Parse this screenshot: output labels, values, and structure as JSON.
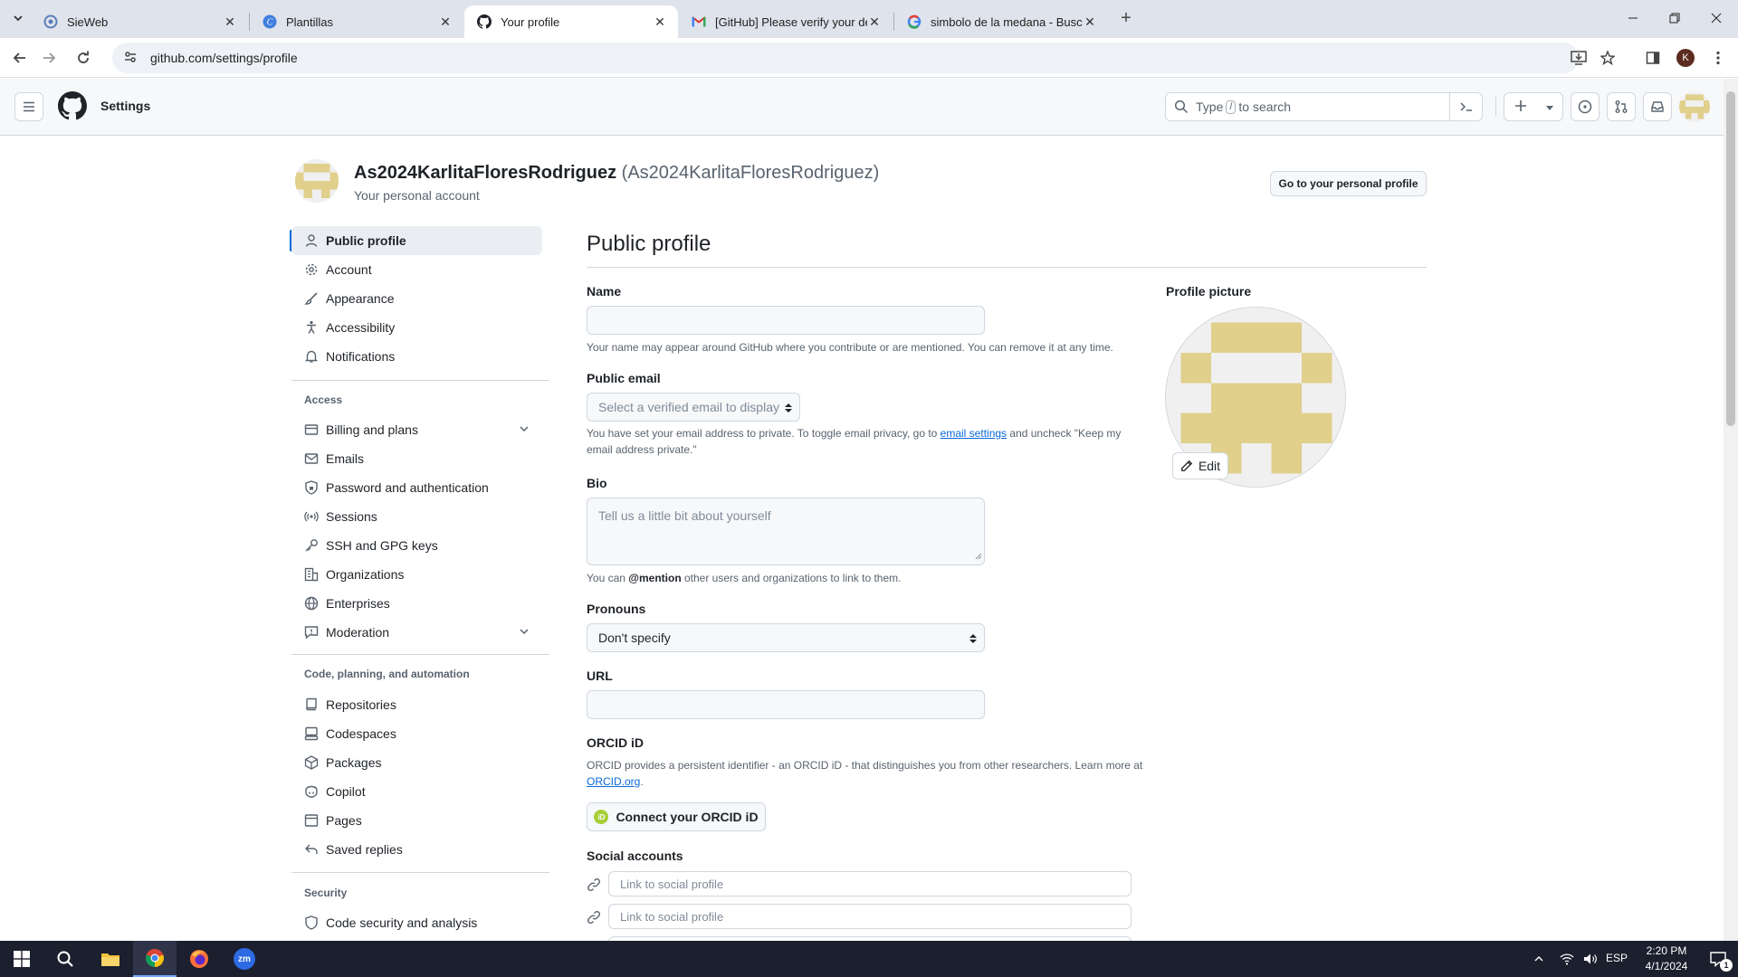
{
  "browser": {
    "tabs": [
      {
        "title": "SieWeb",
        "icon": "sieweb-favicon"
      },
      {
        "title": "Plantillas",
        "icon": "canva-favicon"
      },
      {
        "title": "Your profile",
        "icon": "github-favicon"
      },
      {
        "title": "[GitHub] Please verify your devi",
        "icon": "gmail-favicon"
      },
      {
        "title": "simbolo de la medana - Buscar",
        "icon": "google-favicon"
      }
    ],
    "url": "github.com/settings/profile",
    "profile_initial": "K"
  },
  "header": {
    "context": "Settings",
    "search_prefix": "Type",
    "search_key": "/",
    "search_suffix": "to search"
  },
  "account": {
    "name": "As2024KarlitaFloresRodriguez",
    "handle": "(As2024KarlitaFloresRodriguez)",
    "subtitle": "Your personal account",
    "go_to_profile": "Go to your personal profile"
  },
  "sidebar": {
    "top_items": [
      {
        "label": "Public profile",
        "icon": "person-icon"
      },
      {
        "label": "Account",
        "icon": "gear-icon"
      },
      {
        "label": "Appearance",
        "icon": "paintbrush-icon"
      },
      {
        "label": "Accessibility",
        "icon": "accessibility-icon"
      },
      {
        "label": "Notifications",
        "icon": "bell-icon"
      }
    ],
    "access_title": "Access",
    "access_items": [
      {
        "label": "Billing and plans",
        "icon": "credit-card-icon"
      },
      {
        "label": "Emails",
        "icon": "mail-icon"
      },
      {
        "label": "Password and authentication",
        "icon": "shield-lock-icon"
      },
      {
        "label": "Sessions",
        "icon": "broadcast-icon"
      },
      {
        "label": "SSH and GPG keys",
        "icon": "key-icon"
      },
      {
        "label": "Organizations",
        "icon": "organization-icon"
      },
      {
        "label": "Enterprises",
        "icon": "globe-icon"
      },
      {
        "label": "Moderation",
        "icon": "report-icon"
      }
    ],
    "code_title": "Code, planning, and automation",
    "code_items": [
      {
        "label": "Repositories",
        "icon": "repo-icon"
      },
      {
        "label": "Codespaces",
        "icon": "codespaces-icon"
      },
      {
        "label": "Packages",
        "icon": "package-icon"
      },
      {
        "label": "Copilot",
        "icon": "copilot-icon"
      },
      {
        "label": "Pages",
        "icon": "browser-icon"
      },
      {
        "label": "Saved replies",
        "icon": "reply-icon"
      }
    ],
    "security_title": "Security",
    "security_items": [
      {
        "label": "Code security and analysis",
        "icon": "shield-icon"
      }
    ]
  },
  "main": {
    "title": "Public profile",
    "name_label": "Name",
    "name_value": "",
    "name_note": "Your name may appear around GitHub where you contribute or are mentioned. You can remove it at any time.",
    "email_label": "Public email",
    "email_select": "Select a verified email to display",
    "email_note_1": "You have set your email address to private. To toggle email privacy, go to",
    "email_note_link": "email settings",
    "email_note_2": "and uncheck \"Keep my email address private.\"",
    "bio_label": "Bio",
    "bio_placeholder": "Tell us a little bit about yourself",
    "bio_note_1": "You can",
    "bio_note_mention": "@mention",
    "bio_note_2": "other users and organizations to link to them.",
    "pronouns_label": "Pronouns",
    "pronouns_value": "Don't specify",
    "url_label": "URL",
    "url_value": "",
    "orcid_label": "ORCID iD",
    "orcid_note_1": "ORCID provides a persistent identifier - an ORCID iD - that distinguishes you from other researchers. Learn more at",
    "orcid_note_link": "ORCID.org",
    "orcid_button": "Connect your ORCID iD",
    "orcid_badge": "iD",
    "social_label": "Social accounts",
    "social_placeholder_1": "Link to social profile",
    "social_placeholder_2": "Link to social profile"
  },
  "picture": {
    "label": "Profile picture",
    "edit": "Edit",
    "identicon_color": "#e1cf8c"
  },
  "taskbar": {
    "lang": "ESP",
    "time": "2:20 PM",
    "date": "4/1/2024",
    "notif_count": "1",
    "zoom_label": "zm"
  }
}
